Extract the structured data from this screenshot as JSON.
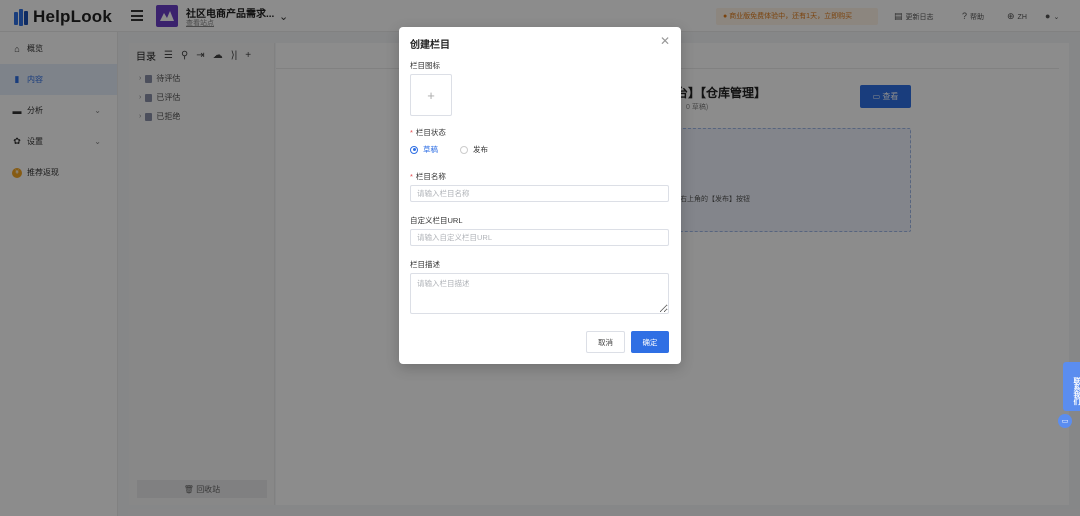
{
  "app": {
    "logo_text": "HelpLook"
  },
  "topbar": {
    "site_name": "社区电商产品需求...",
    "site_link": "查看站点",
    "trial_notice": "商业版免费体验中，还有1天，立即购买",
    "changelog": "更新日志",
    "help": "帮助",
    "language": "ZH"
  },
  "sidebar": {
    "items": [
      {
        "label": "概览",
        "icon": "home-icon"
      },
      {
        "label": "内容",
        "icon": "book-icon",
        "active": true
      },
      {
        "label": "分析",
        "icon": "chart-icon"
      },
      {
        "label": "设置",
        "icon": "gear-icon"
      },
      {
        "label": "推荐返现",
        "icon": "coin-icon"
      }
    ]
  },
  "tree": {
    "title": "目录",
    "nodes": [
      {
        "label": "待评估"
      },
      {
        "label": "已评估"
      },
      {
        "label": "已拒绝"
      }
    ],
    "recycle_bin": "回收站"
  },
  "main": {
    "title": "台】【仓库管理】",
    "count": "0 草稿)",
    "view_button": "查看",
    "dropzone_hint": "右上角的【发布】按钮"
  },
  "modal": {
    "title": "创建栏目",
    "icon_label": "栏目图标",
    "status_label": "栏目状态",
    "status_options": [
      {
        "label": "草稿",
        "selected": true
      },
      {
        "label": "发布",
        "selected": false
      }
    ],
    "name_label": "栏目名称",
    "name_placeholder": "请输入栏目名称",
    "url_label": "自定义栏目URL",
    "url_placeholder": "请输入自定义栏目URL",
    "desc_label": "栏目描述",
    "desc_placeholder": "请输入栏目描述",
    "cancel": "取消",
    "confirm": "确定"
  },
  "contact": {
    "label": "联系我们"
  },
  "colors": {
    "primary": "#2f6fe4",
    "trial_text": "#e07b19",
    "required": "#e5484d"
  }
}
